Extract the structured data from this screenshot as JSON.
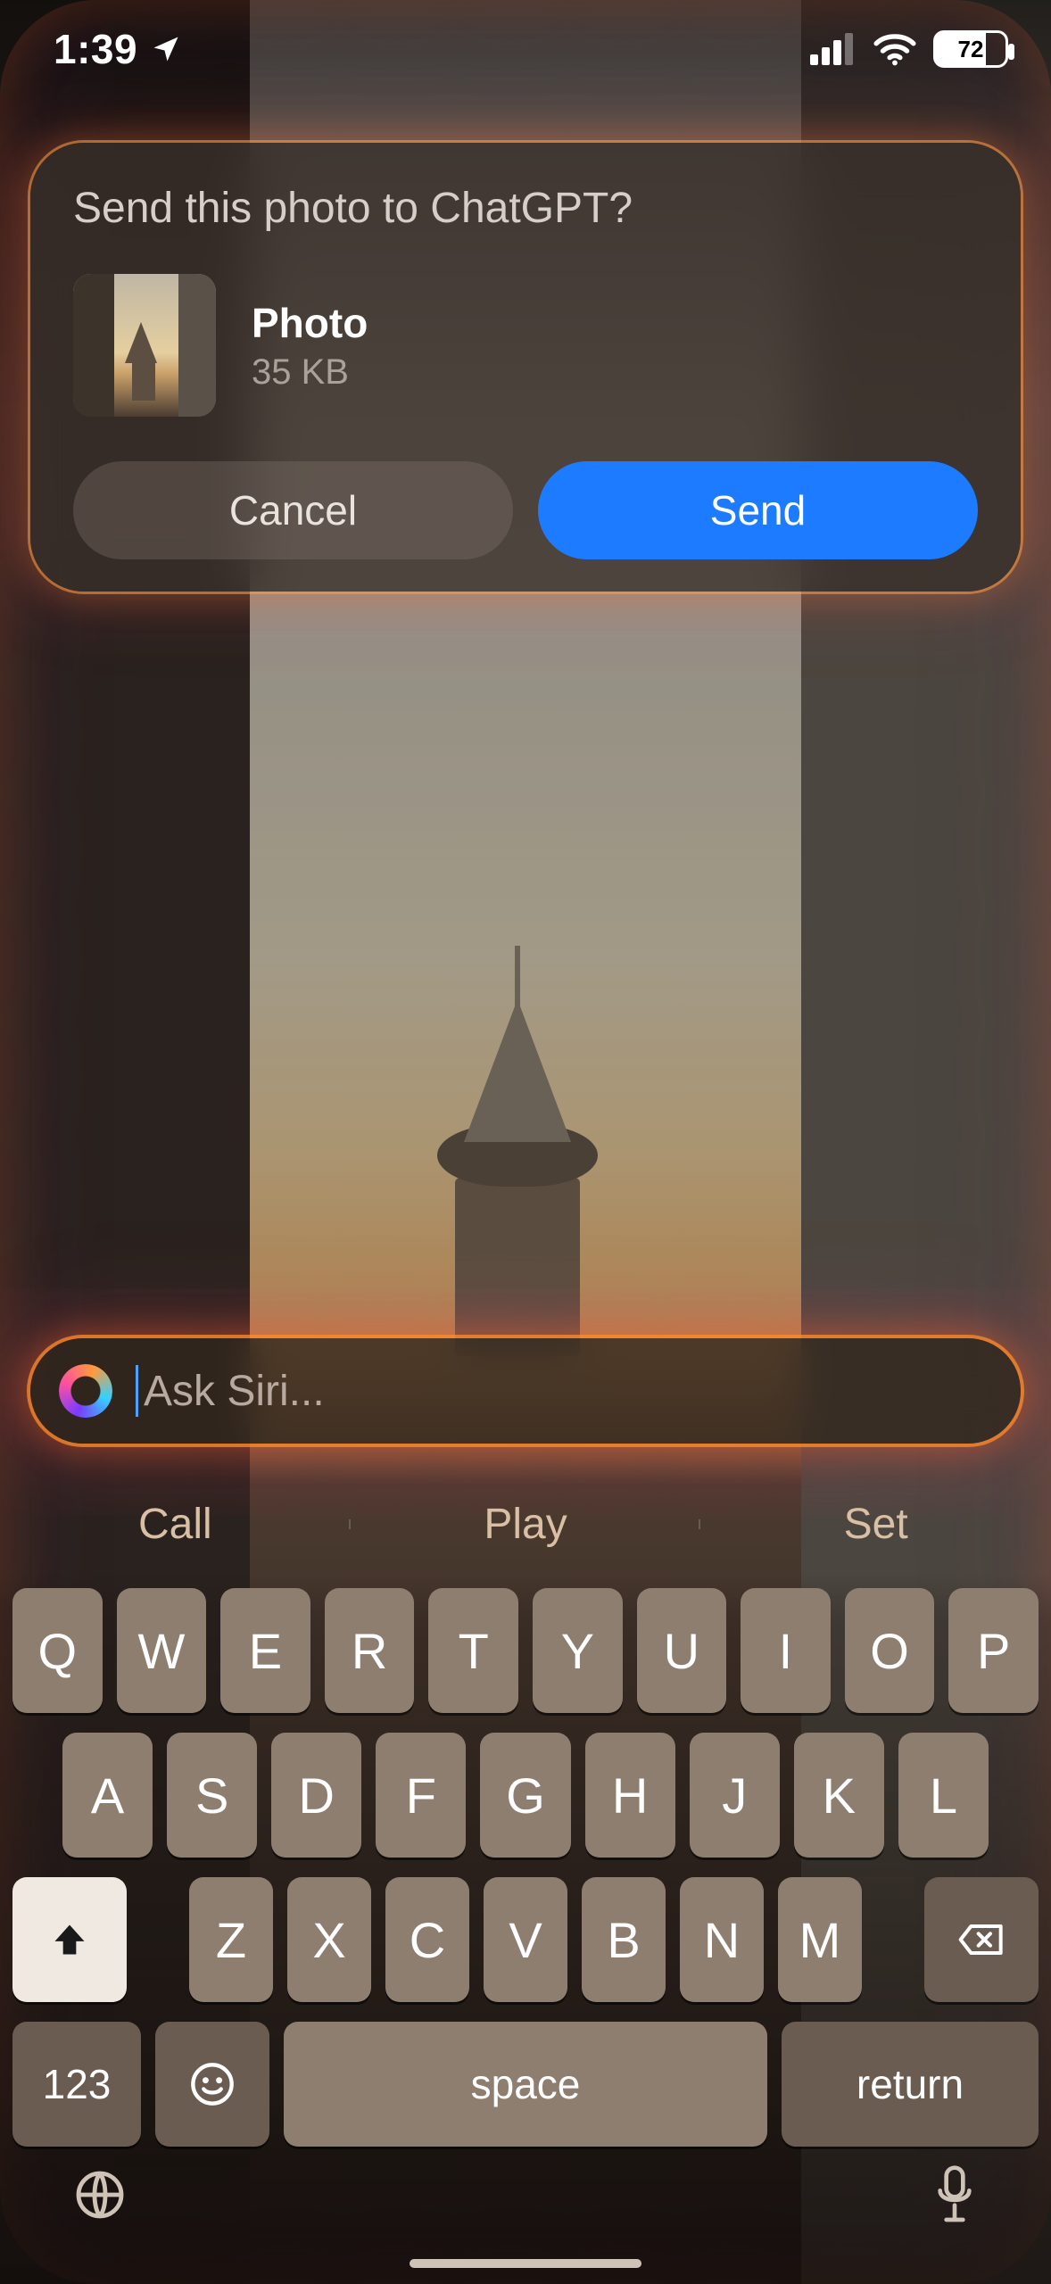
{
  "status": {
    "time": "1:39",
    "battery": "72"
  },
  "sheet": {
    "title": "Send this photo to ChatGPT?",
    "attachment_name": "Photo",
    "attachment_size": "35 KB",
    "cancel": "Cancel",
    "send": "Send"
  },
  "siri": {
    "placeholder": "Ask Siri..."
  },
  "suggestions": [
    "Call",
    "Play",
    "Set"
  ],
  "keyboard": {
    "row1": [
      "Q",
      "W",
      "E",
      "R",
      "T",
      "Y",
      "U",
      "I",
      "O",
      "P"
    ],
    "row2": [
      "A",
      "S",
      "D",
      "F",
      "G",
      "H",
      "J",
      "K",
      "L"
    ],
    "row3": [
      "Z",
      "X",
      "C",
      "V",
      "B",
      "N",
      "M"
    ],
    "numbers": "123",
    "space": "space",
    "return": "return"
  }
}
